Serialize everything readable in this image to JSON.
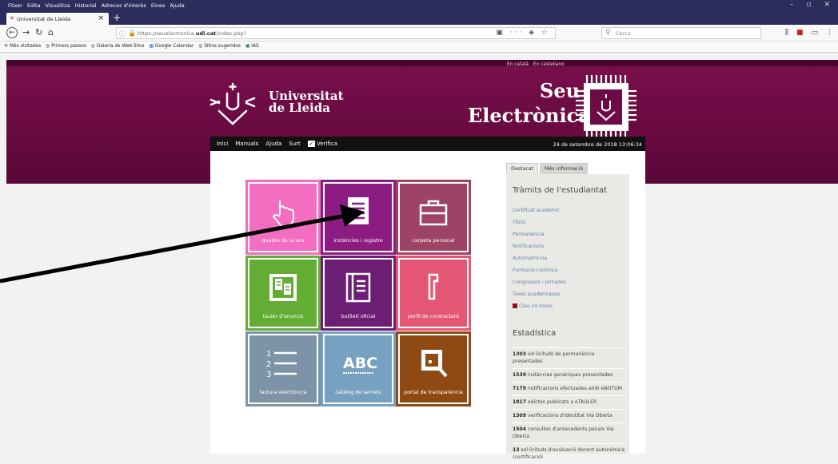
{
  "browser": {
    "menu": [
      "Fitxer",
      "Edita",
      "Visualitza",
      "Historial",
      "Adreces d'interès",
      "Eines",
      "Ajuda"
    ],
    "window_controls": [
      "–",
      "▫",
      "✕"
    ],
    "tab_title": "Universitat de Lleida",
    "url_prefix": "https://seuelectronica.",
    "url_domain": "udl.cat",
    "url_suffix": "/index.php?",
    "search_placeholder": "Cerca",
    "bookmarks": [
      "Més visitades",
      "Primers passos",
      "Galeria de Web Slice",
      "Google Calendar",
      "Sitios sugeridos",
      "IAS"
    ]
  },
  "site": {
    "lang_ca": "En català",
    "lang_es": "En castellano",
    "logo_line1": "Universitat",
    "logo_line2": "de Lleida",
    "seu": "Seu",
    "electronica": "Electrònica",
    "nav": [
      "Inici",
      "Manuals",
      "Ajuda",
      "Surt",
      "Verifica"
    ],
    "date": "24 de setembre de 2018 13:06:34"
  },
  "tiles": [
    {
      "label": "quadre de la seu",
      "icon": "hand-pointer-icon",
      "color": "#f36dc0"
    },
    {
      "label": "instàncies i registre",
      "icon": "document-icon",
      "color": "#8c1c82"
    },
    {
      "label": "carpeta personal",
      "icon": "briefcase-icon",
      "color": "#9d4466"
    },
    {
      "label": "tauler d'anuncis",
      "icon": "notice-board-icon",
      "color": "#63ad35"
    },
    {
      "label": "butlletí oficial",
      "icon": "book-icon",
      "color": "#6c1d74"
    },
    {
      "label": "perfil de contractant",
      "icon": "stamp-icon",
      "color": "#e55675"
    },
    {
      "label": "factura electrònica",
      "icon": "numbered-list-icon",
      "color": "#7c93a8"
    },
    {
      "label": "catàleg de serveis",
      "icon": "abc-icon",
      "color": "#77a1c1"
    },
    {
      "label": "portal de transparència",
      "icon": "magnifier-icon",
      "color": "#8e4a12"
    }
  ],
  "sidebar": {
    "tab_active": "Destacat",
    "tab_other": "Més informació",
    "title": "Tràmits de l'estudiantat",
    "links": [
      "Certificat acadèmic",
      "Títols",
      "Permanència",
      "Notificacions",
      "Automatrícula",
      "Formació contínua",
      "Congressos i jornades",
      "Taxes acadèmiques"
    ],
    "clau": "Clau 24 hores",
    "stats_title": "Estadística",
    "stats": [
      {
        "n": "1303",
        "t": "sol·licituds de permanència presentades"
      },
      {
        "n": "1539",
        "t": "instàncies genèriques presentades"
      },
      {
        "n": "7179",
        "t": "notificacions efectuades amb eNOTUM"
      },
      {
        "n": "1817",
        "t": "edictes publicats a eTAULER"
      },
      {
        "n": "1309",
        "t": "verificacions d'identitat Via Oberta"
      },
      {
        "n": "1504",
        "t": "consultes d'antecedents penals Via Oberta"
      },
      {
        "n": "13",
        "t": "sol·licituds d'avaluació docent autonòmica (certificació)"
      }
    ]
  }
}
